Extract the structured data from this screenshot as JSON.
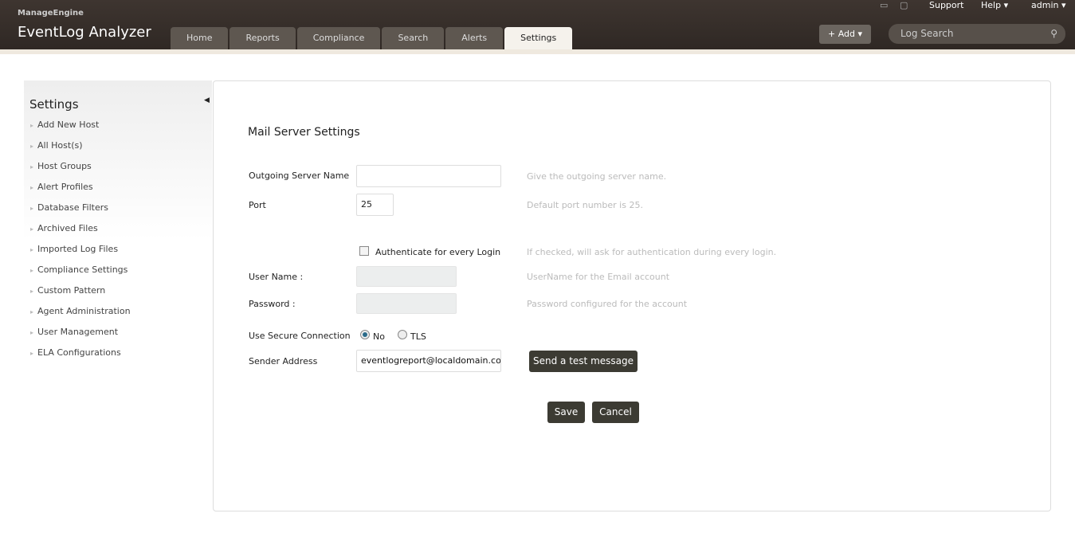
{
  "header": {
    "brand": "ManageEngine",
    "app_title": "EventLog Analyzer",
    "tabs": [
      {
        "label": "Home"
      },
      {
        "label": "Reports"
      },
      {
        "label": "Compliance"
      },
      {
        "label": "Search"
      },
      {
        "label": "Alerts"
      },
      {
        "label": "Settings",
        "active": true
      }
    ],
    "support": "Support",
    "help": "Help ▾",
    "user": "admin ▾",
    "add": "+ Add ▾",
    "log_search_placeholder": "Log Search"
  },
  "sidebar": {
    "title": "Settings",
    "items": [
      {
        "label": "Add New Host"
      },
      {
        "label": "All Host(s)"
      },
      {
        "label": "Host Groups"
      },
      {
        "label": "Alert Profiles"
      },
      {
        "label": "Database Filters"
      },
      {
        "label": "Archived Files"
      },
      {
        "label": "Imported Log Files"
      },
      {
        "label": "Compliance Settings"
      },
      {
        "label": "Custom Pattern"
      },
      {
        "label": "Agent Administration"
      },
      {
        "label": "User Management"
      },
      {
        "label": "ELA Configurations"
      }
    ]
  },
  "form": {
    "title": "Mail Server Settings",
    "server": {
      "label": "Outgoing Server Name",
      "value": "",
      "hint": "Give the outgoing server name."
    },
    "port": {
      "label": "Port",
      "value": "25",
      "hint": "Default port number is 25."
    },
    "auth": {
      "label": "Authenticate for every Login",
      "checked": false,
      "hint": "If checked, will ask for authentication during every login."
    },
    "user": {
      "label": "User Name :",
      "value": "",
      "hint": "UserName for the Email account"
    },
    "password": {
      "label": "Password :",
      "value": "",
      "hint": "Password configured for the account"
    },
    "secure": {
      "label": "Use Secure Connection",
      "options": [
        "No",
        "TLS"
      ],
      "selected": "No"
    },
    "sender": {
      "label": "Sender Address",
      "value": "eventlogreport@localdomain.com"
    },
    "test_button": "Send a test message",
    "save": "Save",
    "cancel": "Cancel"
  }
}
